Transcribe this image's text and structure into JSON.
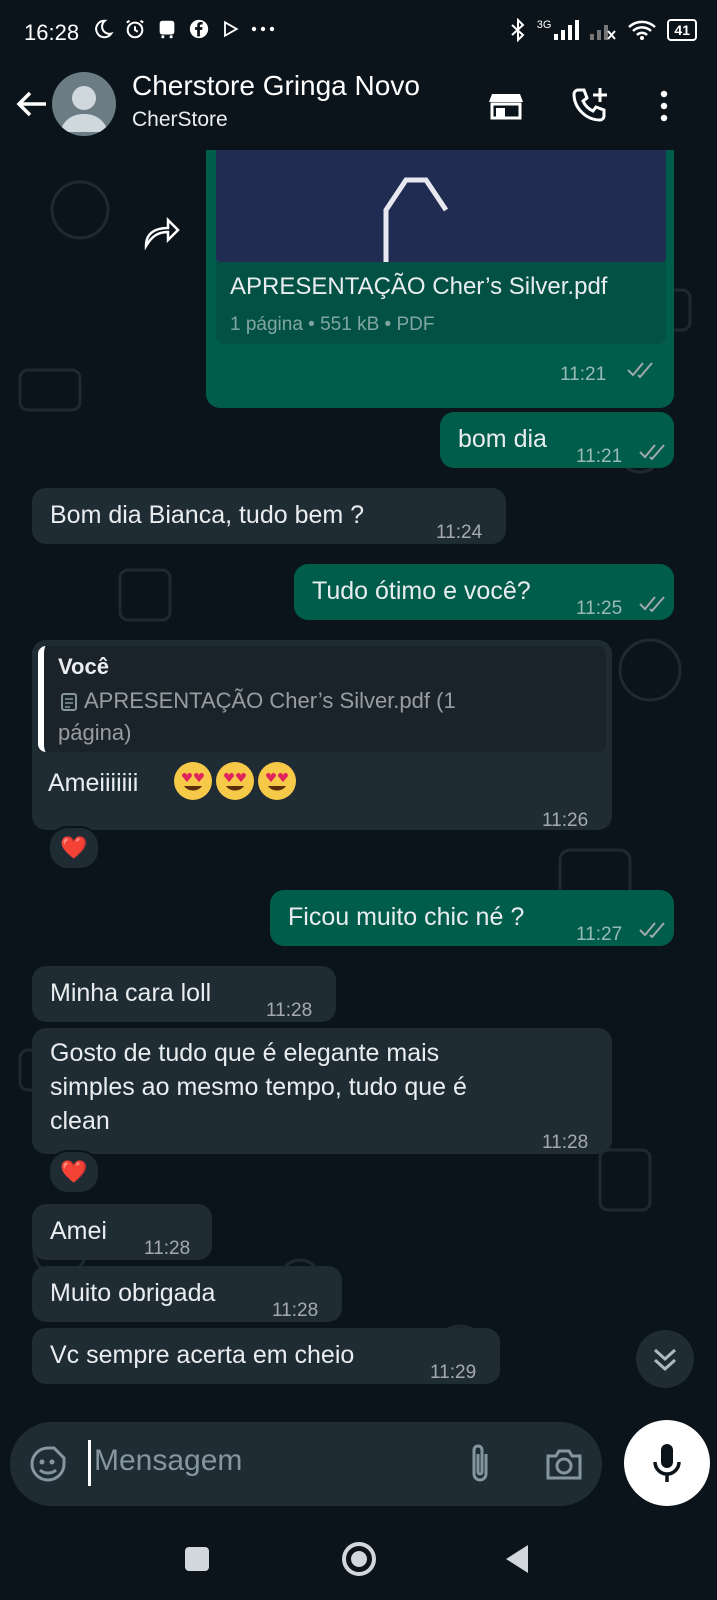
{
  "status_bar": {
    "time": "16:28",
    "battery": "41",
    "network": "3G"
  },
  "header": {
    "title": "Cherstore Gringa Novo",
    "subtitle": "CherStore"
  },
  "messages": {
    "pdf": {
      "filename": "APRESENTAÇÃO Cher’s Silver.pdf",
      "meta": "1 página • 551 kB • PDF",
      "time": "11:21"
    },
    "m1": {
      "text": "bom dia",
      "time": "11:21"
    },
    "m2": {
      "text": "Bom dia Bianca, tudo bem ?",
      "time": "11:24"
    },
    "m3": {
      "text": "Tudo ótimo e você?",
      "time": "11:25"
    },
    "m4": {
      "quote_author": "Você",
      "quote_line1": "APRESENTAÇÃO Cher’s Silver.pdf (1",
      "quote_line2": "página)",
      "text": "Ameiiiiiii",
      "time": "11:26",
      "reaction": "❤️"
    },
    "m5": {
      "text": "Ficou muito chic né ?",
      "time": "11:27"
    },
    "m6": {
      "text": "Minha cara loll",
      "time": "11:28"
    },
    "m7": {
      "line1": "Gosto de tudo que é elegante mais",
      "line2": "simples ao mesmo tempo, tudo que é",
      "line3": "clean",
      "time": "11:28",
      "reaction": "❤️"
    },
    "m8": {
      "text": "Amei",
      "time": "11:28"
    },
    "m9": {
      "text": "Muito obrigada",
      "time": "11:28"
    },
    "m10": {
      "text": "Vc sempre acerta em cheio",
      "time": "11:29"
    }
  },
  "composer": {
    "placeholder": "Mensagem"
  },
  "colors": {
    "background": "#0b141a",
    "outgoing_bubble": "#005c4b",
    "incoming_bubble": "#202c33",
    "tick_read": "#a0a9ad"
  }
}
